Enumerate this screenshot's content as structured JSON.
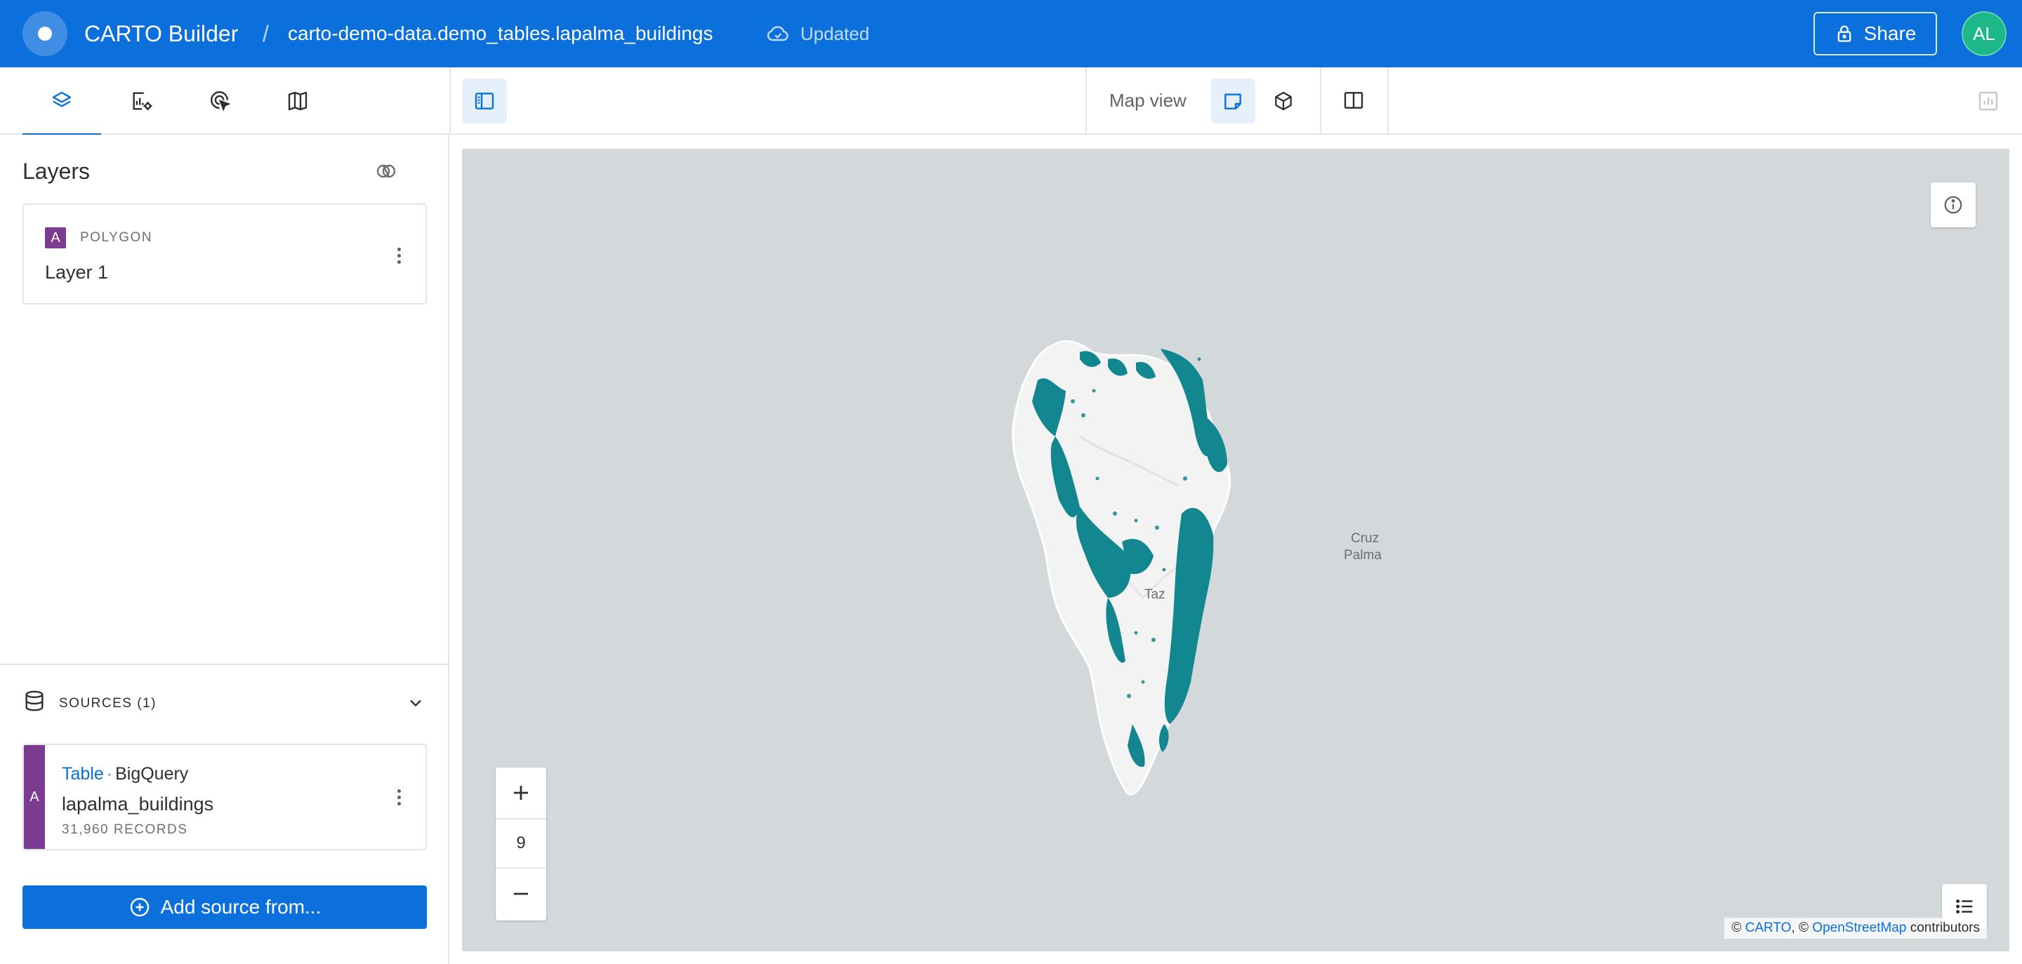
{
  "header": {
    "app_title": "CARTO Builder",
    "separator": "/",
    "breadcrumb": "carto-demo-data.demo_tables.lapalma_buildings",
    "status": "Updated",
    "share_label": "Share",
    "avatar_initials": "AL"
  },
  "toolbar": {
    "map_view_label": "Map view"
  },
  "layers": {
    "title": "Layers",
    "items": [
      {
        "badge": "A",
        "type": "POLYGON",
        "name": "Layer 1"
      }
    ]
  },
  "sources": {
    "label": "SOURCES (1)",
    "items": [
      {
        "badge": "A",
        "kind": "Table",
        "separator": "·",
        "provider": "BigQuery",
        "name": "lapalma_buildings",
        "records": "31,960 RECORDS"
      }
    ],
    "add_label": "Add source from..."
  },
  "map": {
    "zoom_level": "9",
    "labels": {
      "cruz": "Cruz",
      "palma": "Palma",
      "taz": "Taz"
    },
    "attribution": {
      "copy1": "©",
      "carto": "CARTO",
      "sep": ", ©",
      "osm": "OpenStreetMap",
      "tail": "contributors"
    },
    "layer_color": "#12878f"
  },
  "colors": {
    "brand_blue": "#0b6fdc",
    "layer_purple": "#7b3b91",
    "avatar_green": "#1db887"
  }
}
